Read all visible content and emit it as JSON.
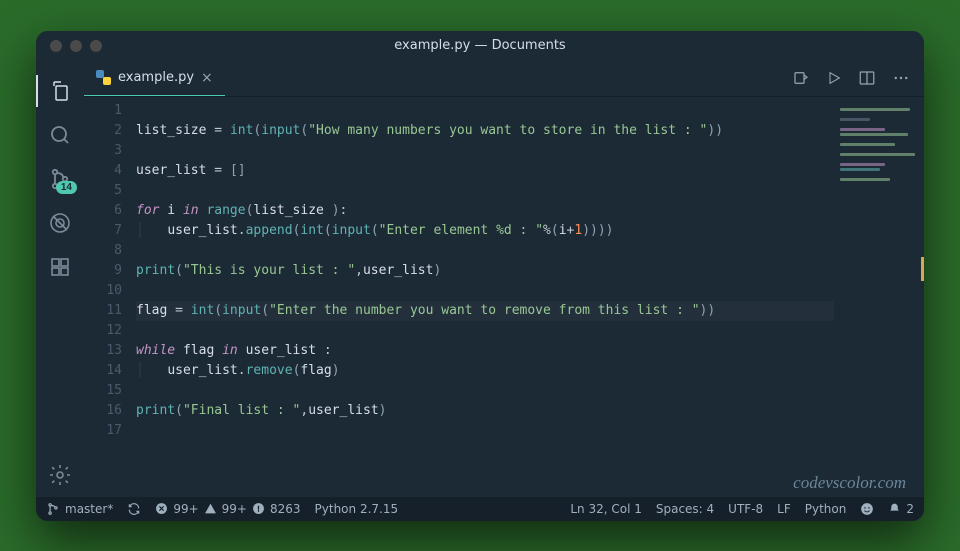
{
  "window": {
    "title": "example.py — Documents"
  },
  "activity": {
    "scm_badge": "14"
  },
  "tab": {
    "filename": "example.py",
    "close": "×"
  },
  "code": {
    "line_count": 17,
    "lines": [
      [],
      [
        [
          "id",
          "list_size"
        ],
        [
          "op",
          " = "
        ],
        [
          "fn",
          "int"
        ],
        [
          "pun",
          "("
        ],
        [
          "fn",
          "input"
        ],
        [
          "pun",
          "("
        ],
        [
          "str",
          "\"How many numbers you want to store in the list : \""
        ],
        [
          "pun",
          "))"
        ]
      ],
      [],
      [
        [
          "id",
          "user_list"
        ],
        [
          "op",
          " = "
        ],
        [
          "pun",
          "[]"
        ]
      ],
      [],
      [
        [
          "kw",
          "for"
        ],
        [
          "id",
          " i "
        ],
        [
          "kw",
          "in"
        ],
        [
          "op",
          " "
        ],
        [
          "fn",
          "range"
        ],
        [
          "pun",
          "("
        ],
        [
          "id",
          "list_size "
        ],
        [
          "pun",
          ")"
        ],
        [
          "op",
          ":"
        ]
      ],
      [
        [
          "guide",
          "│   "
        ],
        [
          "id",
          "user_list"
        ],
        [
          "op",
          "."
        ],
        [
          "fn",
          "append"
        ],
        [
          "pun",
          "("
        ],
        [
          "fn",
          "int"
        ],
        [
          "pun",
          "("
        ],
        [
          "fn",
          "input"
        ],
        [
          "pun",
          "("
        ],
        [
          "str",
          "\"Enter element %d : \""
        ],
        [
          "op",
          "%"
        ],
        [
          "pun",
          "("
        ],
        [
          "id",
          "i"
        ],
        [
          "op",
          "+"
        ],
        [
          "num",
          "1"
        ],
        [
          "pun",
          "))))"
        ]
      ],
      [],
      [
        [
          "fn",
          "print"
        ],
        [
          "pun",
          "("
        ],
        [
          "str",
          "\"This is your list : \""
        ],
        [
          "op",
          ","
        ],
        [
          "id",
          "user_list"
        ],
        [
          "pun",
          ")"
        ]
      ],
      [],
      [
        [
          "id",
          "flag"
        ],
        [
          "op",
          " = "
        ],
        [
          "fn",
          "int"
        ],
        [
          "pun",
          "("
        ],
        [
          "fn",
          "input"
        ],
        [
          "pun",
          "("
        ],
        [
          "str",
          "\"Enter the number you want to remove from this list : \""
        ],
        [
          "pun",
          "))"
        ]
      ],
      [],
      [
        [
          "kw",
          "while"
        ],
        [
          "id",
          " flag "
        ],
        [
          "kw",
          "in"
        ],
        [
          "id",
          " user_list "
        ],
        [
          "op",
          ":"
        ]
      ],
      [
        [
          "guide",
          "│   "
        ],
        [
          "id",
          "user_list"
        ],
        [
          "op",
          "."
        ],
        [
          "fn",
          "remove"
        ],
        [
          "pun",
          "("
        ],
        [
          "id",
          "flag"
        ],
        [
          "pun",
          ")"
        ]
      ],
      [],
      [
        [
          "fn",
          "print"
        ],
        [
          "pun",
          "("
        ],
        [
          "str",
          "\"Final list : \""
        ],
        [
          "op",
          ","
        ],
        [
          "id",
          "user_list"
        ],
        [
          "pun",
          ")"
        ]
      ],
      []
    ],
    "highlight_line": 11
  },
  "watermark": "codevscolor.com",
  "status": {
    "branch": "master*",
    "errors": "99+",
    "warnings": "99+",
    "info": "8263",
    "interpreter": "Python 2.7.15",
    "cursor": "Ln 32, Col 1",
    "indent": "Spaces: 4",
    "encoding": "UTF-8",
    "eol": "LF",
    "language": "Python",
    "notifications": "2"
  }
}
